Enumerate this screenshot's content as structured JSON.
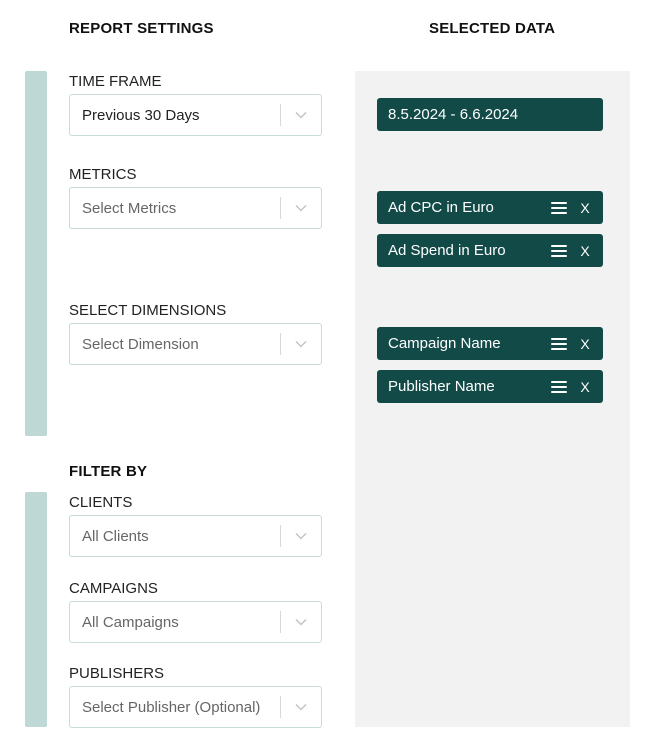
{
  "headers": {
    "report_settings": "REPORT SETTINGS",
    "selected_data": "SELECTED DATA",
    "filter_by": "FILTER BY"
  },
  "time_frame": {
    "label": "TIME FRAME",
    "value": "Previous 30 Days"
  },
  "metrics": {
    "label": "METRICS",
    "placeholder": "Select Metrics"
  },
  "dimensions": {
    "label": "SELECT DIMENSIONS",
    "placeholder": "Select Dimension"
  },
  "clients": {
    "label": "CLIENTS",
    "value": "All Clients"
  },
  "campaigns": {
    "label": "CAMPAIGNS",
    "value": "All Campaigns"
  },
  "publishers": {
    "label": "PUBLISHERS",
    "placeholder": "Select Publisher (Optional)"
  },
  "selected": {
    "date_range": "8.5.2024 - 6.6.2024",
    "metrics": [
      {
        "label": "Ad CPC in Euro",
        "remove": "X"
      },
      {
        "label": "Ad Spend in Euro",
        "remove": "X"
      }
    ],
    "dimensions": [
      {
        "label": "Campaign Name",
        "remove": "X"
      },
      {
        "label": "Publisher Name",
        "remove": "X"
      }
    ]
  },
  "colors": {
    "accent_bar": "#bdd8d5",
    "chip_background": "#124a48",
    "panel_background": "#f2f2f2",
    "select_border": "#c8dcd9"
  },
  "icons": {
    "dropdown": "chevron-down-icon",
    "drag": "drag-handle-icon"
  }
}
